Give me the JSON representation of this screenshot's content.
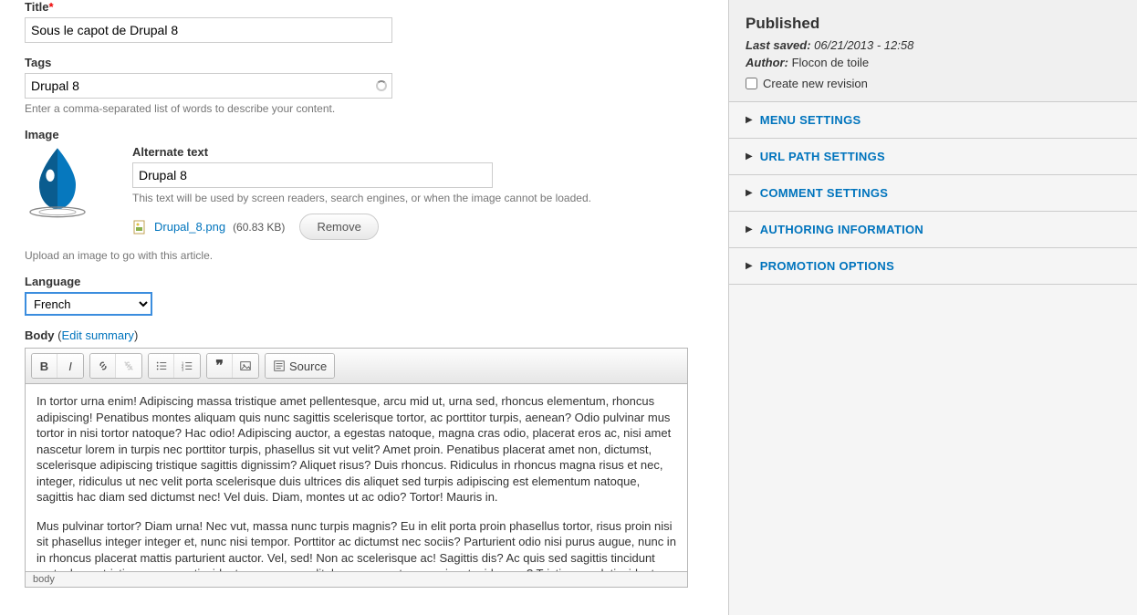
{
  "fields": {
    "title": {
      "label": "Title",
      "value": "Sous le capot de Drupal 8"
    },
    "tags": {
      "label": "Tags",
      "value": "Drupal 8",
      "description": "Enter a comma-separated list of words to describe your content."
    },
    "image": {
      "label": "Image",
      "alt_label": "Alternate text",
      "alt_value": "Drupal 8",
      "alt_description": "This text will be used by screen readers, search engines, or when the image cannot be loaded.",
      "filename": "Drupal_8.png",
      "filesize": "(60.83 KB)",
      "remove_label": "Remove",
      "upload_description": "Upload an image to go with this article."
    },
    "language": {
      "label": "Language",
      "value": "French"
    },
    "body": {
      "label": "Body",
      "edit_summary": "Edit summary",
      "source_label": "Source",
      "status_path": "body",
      "paragraph1": "In tortor urna enim! Adipiscing massa tristique amet pellentesque, arcu mid ut, urna sed, rhoncus elementum, rhoncus adipiscing! Penatibus montes aliquam quis nunc sagittis scelerisque tortor, ac porttitor turpis, aenean? Odio pulvinar mus tortor in nisi tortor natoque? Hac odio! Adipiscing auctor, a egestas natoque, magna cras odio, placerat eros ac, nisi amet nascetur lorem in turpis nec porttitor turpis, phasellus sit vut velit? Amet proin. Penatibus placerat amet non, dictumst, scelerisque adipiscing tristique sagittis dignissim? Aliquet risus? Duis rhoncus. Ridiculus in rhoncus magna risus et nec, integer, ridiculus ut nec velit porta scelerisque duis ultrices dis aliquet sed turpis adipiscing est elementum natoque, sagittis hac diam sed dictumst nec! Vel duis. Diam, montes ut ac odio? Tortor! Mauris in.",
      "paragraph2": "Mus pulvinar tortor? Diam urna! Nec vut, massa nunc turpis magnis? Eu in elit porta proin phasellus tortor, risus proin nisi sit phasellus integer integer et, nunc nisi tempor. Porttitor ac dictumst nec sociis? Parturient odio nisi purus augue, nunc in in rhoncus placerat mattis parturient auctor. Vel, sed! Non ac scelerisque ac! Sagittis dis? Ac quis sed sagittis tincidunt porta, lorem tristique, aenean tincidunt mus augue velit, lorem, nascetur, a, enim ut mid purus? Tristique sed, tincidunt integer. A porta magnis ultricies hac nunc pellentesque, porta, porta sed placerat odio. Nascetur tempor augue in. Ultricies cras, eu! Tempor non"
    }
  },
  "sidebar": {
    "status": "Published",
    "last_saved_label": "Last saved:",
    "last_saved_value": "06/21/2013 - 12:58",
    "author_label": "Author:",
    "author_value": "Flocon de toile",
    "revision_label": "Create new revision",
    "sections": [
      {
        "title": "MENU SETTINGS"
      },
      {
        "title": "URL PATH SETTINGS"
      },
      {
        "title": "COMMENT SETTINGS"
      },
      {
        "title": "AUTHORING INFORMATION"
      },
      {
        "title": "PROMOTION OPTIONS"
      }
    ]
  }
}
